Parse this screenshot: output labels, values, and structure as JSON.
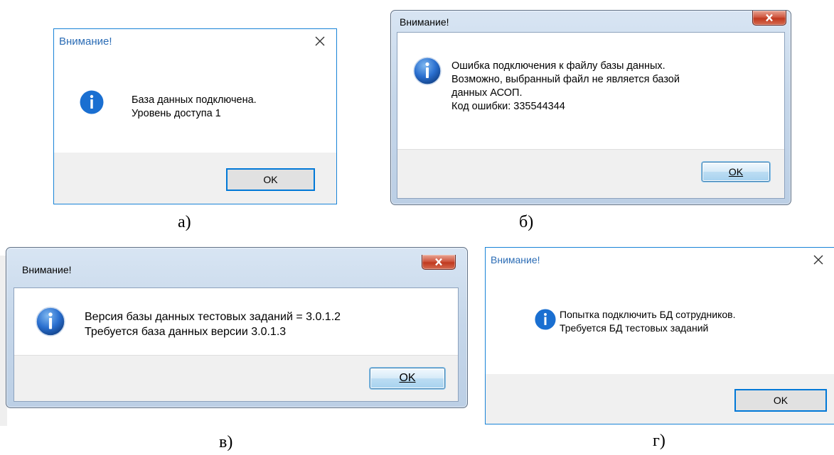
{
  "dialogs": [
    {
      "id": "a",
      "title": "Внимание!",
      "lines": [
        "База данных подключена.",
        "Уровень доступа 1"
      ],
      "ok_label": "OK",
      "caption": "а)"
    },
    {
      "id": "b",
      "title": "Внимание!",
      "lines": [
        "Ошибка подключения к файлу базы данных.",
        "Возможно, выбранный файл не является базой",
        "данных АСОП.",
        "Код ошибки: 335544344"
      ],
      "ok_label": "OK",
      "caption": "б)"
    },
    {
      "id": "c",
      "title": "Внимание!",
      "lines": [
        "Версия базы данных тестовых заданий = 3.0.1.2",
        "Требуется база данных версии 3.0.1.3"
      ],
      "ok_label": "OK",
      "caption": "в)"
    },
    {
      "id": "d",
      "title": "Внимание!",
      "lines": [
        "Попытка подключить БД сотрудников.",
        "Требуется БД тестовых заданий"
      ],
      "ok_label": "OK",
      "caption": "г)"
    }
  ],
  "colors": {
    "win10_border": "#1883d7",
    "win10_title": "#2b6cb5",
    "win7_close": "#c0391f",
    "info_icon": "#1a6fd1"
  },
  "icons": [
    "info-icon",
    "close-icon"
  ]
}
